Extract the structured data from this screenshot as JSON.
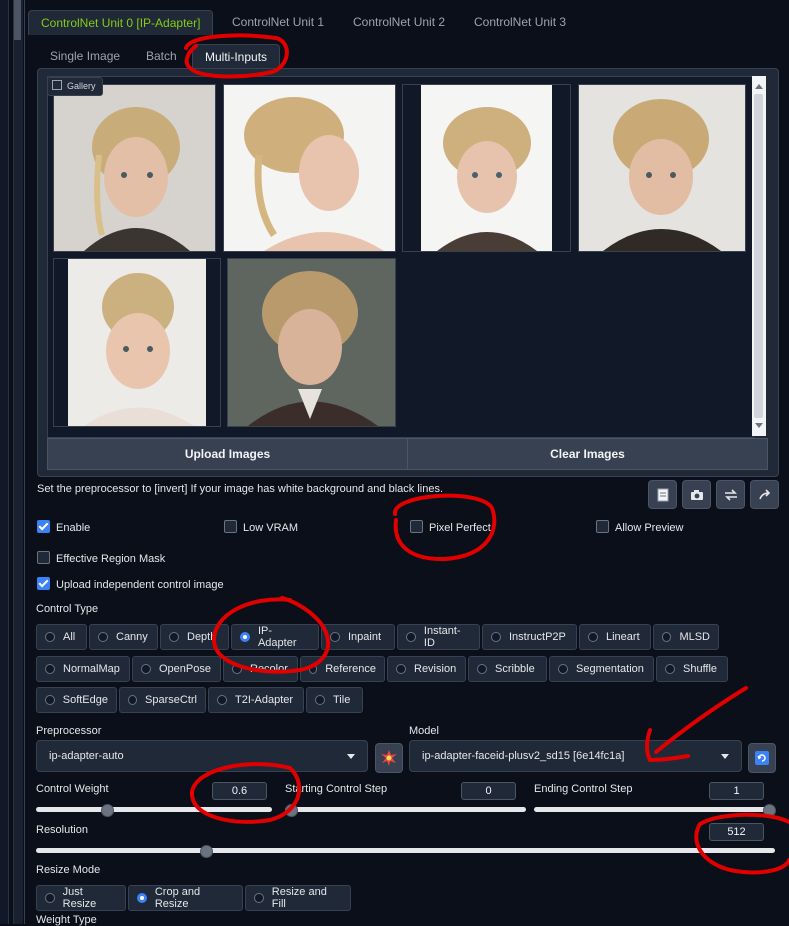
{
  "unit_tabs": [
    "ControlNet Unit 0 [IP-Adapter]",
    "ControlNet Unit 1",
    "ControlNet Unit 2",
    "ControlNet Unit 3"
  ],
  "input_tabs": [
    "Single Image",
    "Batch",
    "Multi-Inputs"
  ],
  "gallery": {
    "label": "Gallery",
    "image_count": 6
  },
  "buttons": {
    "upload_images": "Upload Images",
    "clear_images": "Clear Images"
  },
  "hint_text": "Set the preprocessor to [invert] If your image has white background and black lines.",
  "tool_icons": [
    "notepad-icon",
    "camera-icon",
    "swap-icon",
    "send-arrow-icon"
  ],
  "options": {
    "enable": "Enable",
    "low_vram": "Low VRAM",
    "pixel_perfect": "Pixel Perfect",
    "allow_preview": "Allow Preview",
    "effective_region_mask": "Effective Region Mask",
    "upload_independent": "Upload independent control image"
  },
  "option_states": {
    "enable": true,
    "low_vram": false,
    "pixel_perfect": false,
    "allow_preview": false,
    "effective_region_mask": false,
    "upload_independent": true
  },
  "control_type": {
    "label": "Control Type",
    "selected": "IP-Adapter",
    "row1": [
      "All",
      "Canny",
      "Depth",
      "IP-Adapter",
      "Inpaint",
      "Instant-ID",
      "InstructP2P",
      "Lineart",
      "MLSD"
    ],
    "row2": [
      "NormalMap",
      "OpenPose",
      "Recolor",
      "Reference",
      "Revision",
      "Scribble",
      "Segmentation",
      "Shuffle"
    ],
    "row3": [
      "SoftEdge",
      "SparseCtrl",
      "T2I-Adapter",
      "Tile"
    ]
  },
  "preprocessor": {
    "label": "Preprocessor",
    "value": "ip-adapter-auto"
  },
  "model": {
    "label": "Model",
    "value": "ip-adapter-faceid-plusv2_sd15 [6e14fc1a]"
  },
  "control_weight": {
    "label": "Control Weight",
    "value": "0.6",
    "fraction": 0.3
  },
  "starting_step": {
    "label": "Starting Control Step",
    "value": "0",
    "fraction": 0
  },
  "ending_step": {
    "label": "Ending Control Step",
    "value": "1",
    "fraction": 1
  },
  "resolution": {
    "label": "Resolution",
    "value": "512",
    "fraction": 0.23
  },
  "resize_mode": {
    "label": "Resize Mode",
    "options": [
      "Just Resize",
      "Crop and Resize",
      "Resize and Fill"
    ],
    "selected": "Crop and Resize"
  },
  "weight_type_label": "Weight Type",
  "colors": {
    "accent_green": "#84cc16",
    "accent_blue": "#3b82f6",
    "annotation_red": "#e00000"
  }
}
